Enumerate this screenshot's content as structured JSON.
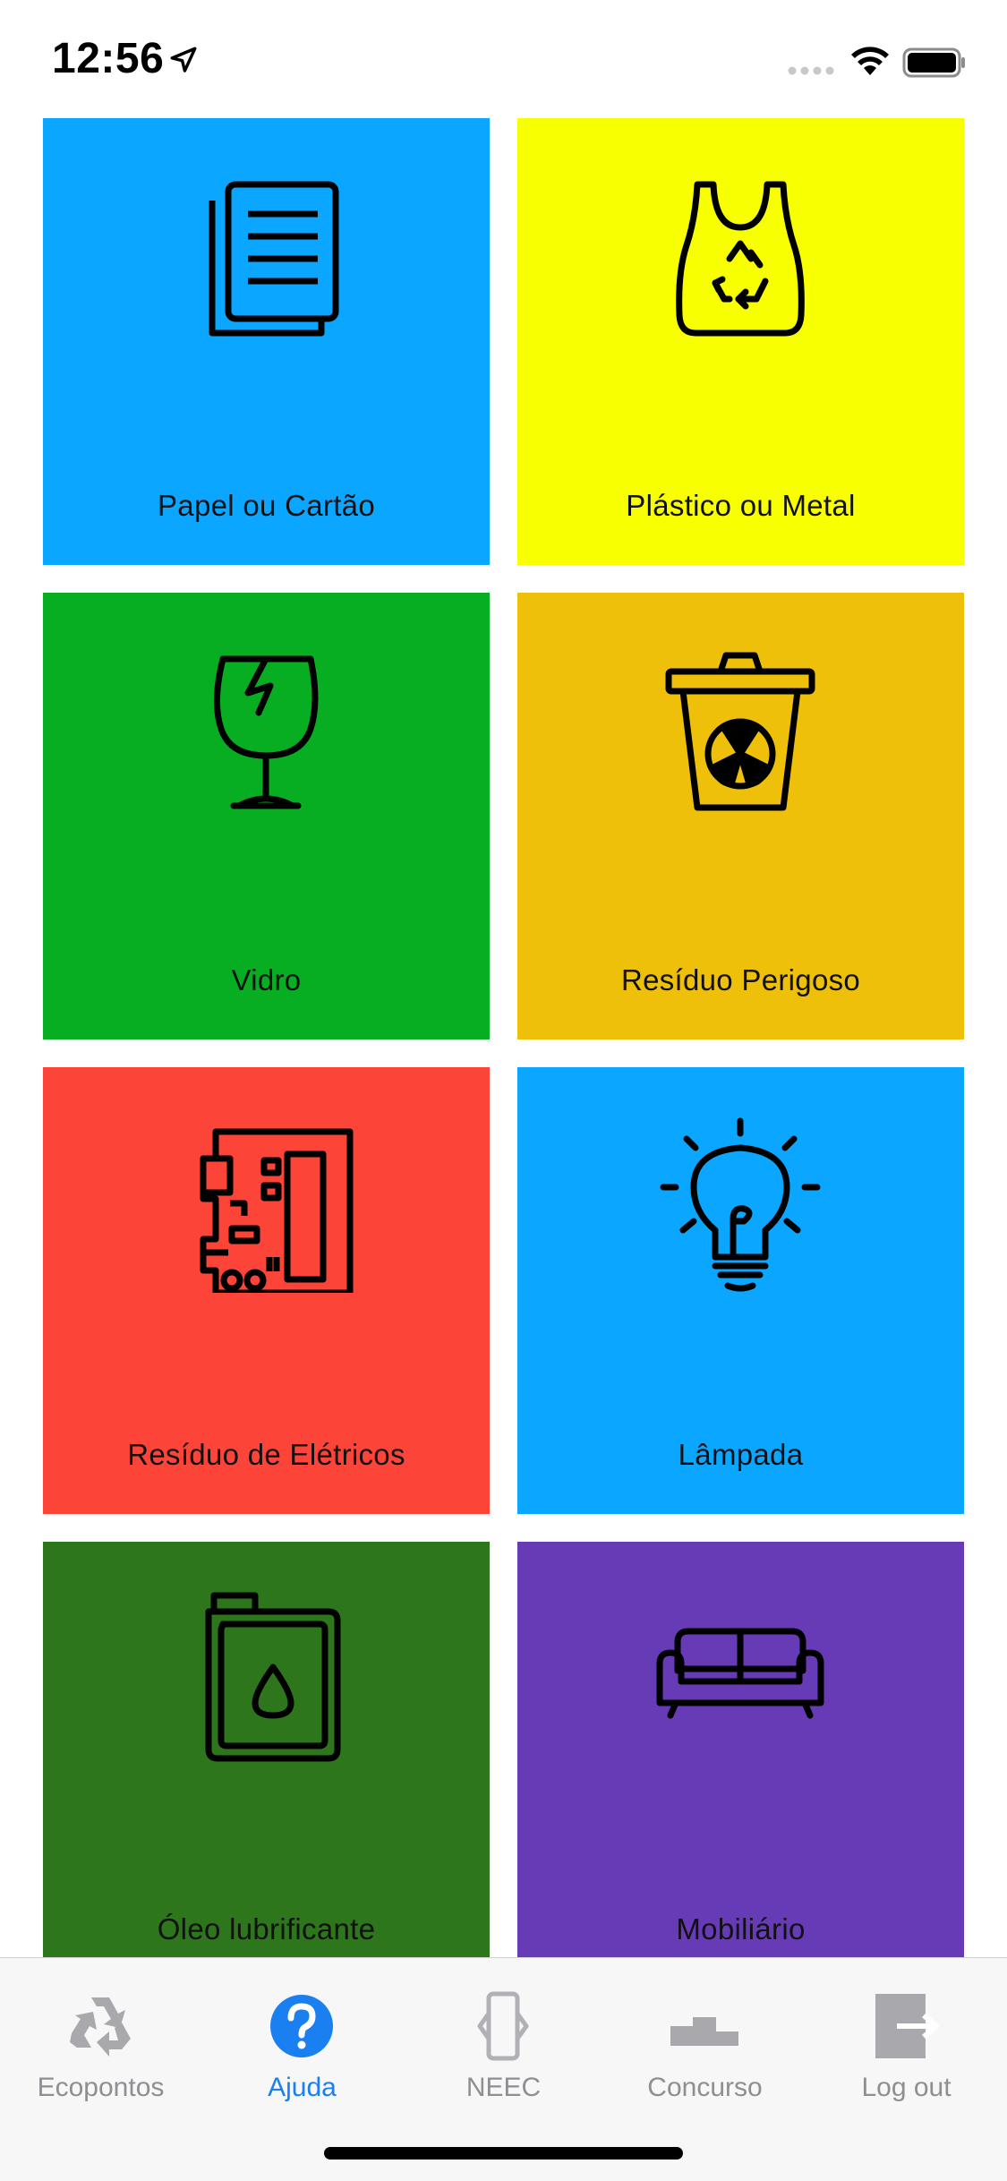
{
  "status_bar": {
    "time": "12:56"
  },
  "tiles": [
    {
      "label": "Papel ou Cartão",
      "icon": "documents-icon",
      "color": "#0aa6ff"
    },
    {
      "label": "Plástico ou Metal",
      "icon": "recycle-bag-icon",
      "color": "#f7ff00"
    },
    {
      "label": "Vidro",
      "icon": "broken-glass-icon",
      "color": "#07ae22"
    },
    {
      "label": "Resíduo Perigoso",
      "icon": "hazard-bin-icon",
      "color": "#eec00a"
    },
    {
      "label": "Resíduo de Elétricos",
      "icon": "circuit-board-icon",
      "color": "#fc4538"
    },
    {
      "label": "Lâmpada",
      "icon": "light-bulb-icon",
      "color": "#0aa6ff"
    },
    {
      "label": "Óleo lubrificante",
      "icon": "oil-can-icon",
      "color": "#2d761b"
    },
    {
      "label": "Mobiliário",
      "icon": "sofa-icon",
      "color": "#673ab6"
    }
  ],
  "tab_bar": {
    "active_color": "#1a7ff0",
    "inactive_color": "#8e8e93",
    "tabs": [
      {
        "label": "Ecopontos",
        "icon": "recycle-icon",
        "active": false
      },
      {
        "label": "Ajuda",
        "icon": "help-icon",
        "active": true
      },
      {
        "label": "NEEC",
        "icon": "phone-icon",
        "active": false
      },
      {
        "label": "Concurso",
        "icon": "podium-icon",
        "active": false
      },
      {
        "label": "Log out",
        "icon": "logout-icon",
        "active": false
      }
    ]
  }
}
